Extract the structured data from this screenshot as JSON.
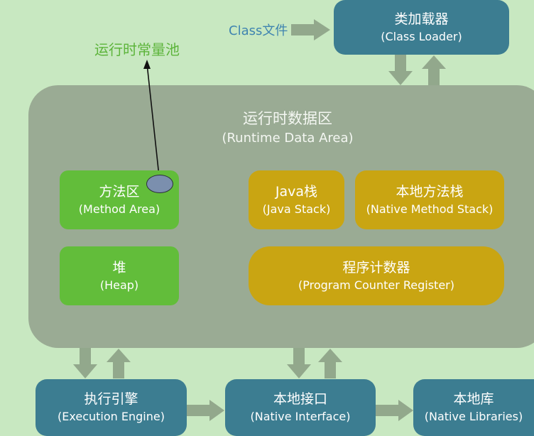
{
  "class_file": "Class文件",
  "constant_pool": "运行时常量池",
  "class_loader": {
    "zh": "类加载器",
    "en": "(Class Loader)"
  },
  "runtime_area": {
    "zh": "运行时数据区",
    "en": "(Runtime Data Area)"
  },
  "method_area": {
    "zh": "方法区",
    "en": "(Method Area)"
  },
  "heap": {
    "zh": "堆",
    "en": "(Heap)"
  },
  "java_stack": {
    "zh": "Java栈",
    "en": "(Java Stack)"
  },
  "native_stack": {
    "zh": "本地方法栈",
    "en": "(Native Method Stack)"
  },
  "pc_register": {
    "zh": "程序计数器",
    "en": "(Program Counter Register)"
  },
  "execution_engine": {
    "zh": "执行引擎",
    "en": "(Execution Engine)"
  },
  "native_interface": {
    "zh": "本地接口",
    "en": "(Native Interface)"
  },
  "native_libraries": {
    "zh": "本地库",
    "en": "(Native Libraries)"
  },
  "colors": {
    "background": "#c8e8c1",
    "teal_box": "#3c7d91",
    "green_box": "#62bd3a",
    "gold_box": "#c9a512",
    "runtime_area": "#9aab94",
    "arrow": "#92a88c",
    "pool_marker": "#7b8fae"
  }
}
